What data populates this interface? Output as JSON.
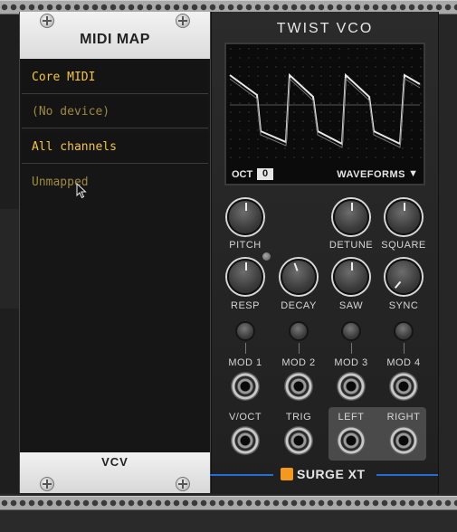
{
  "midi_map": {
    "title": "MIDI MAP",
    "rows": [
      {
        "text": "Core MIDI",
        "style": "bright"
      },
      {
        "text": "(No device)",
        "style": "dim"
      },
      {
        "text": "All channels",
        "style": "bright"
      },
      {
        "text": "Unmapped",
        "style": "dim"
      }
    ],
    "footer_logo": "VCV"
  },
  "vco": {
    "title": "TWIST VCO",
    "scope": {
      "oct_label": "OCT",
      "oct_value": "0",
      "waveforms_label": "WAVEFORMS",
      "waveforms_arrow": "▼"
    },
    "knobs_row1": [
      "PITCH",
      "DETUNE",
      "SQUARE"
    ],
    "knobs_row2": [
      "RESP",
      "DECAY",
      "SAW",
      "SYNC"
    ],
    "mod_labels": [
      "MOD 1",
      "MOD 2",
      "MOD 3",
      "MOD 4"
    ],
    "io_labels": [
      "V/OCT",
      "TRIG",
      "LEFT",
      "RIGHT"
    ],
    "brand": "SURGE XT"
  },
  "colors": {
    "midi_text_bright": "#f3c640",
    "midi_text_dim": "#9d8a3c",
    "surge_accent": "#1f6fd6",
    "surge_logo": "#f39a1e"
  }
}
